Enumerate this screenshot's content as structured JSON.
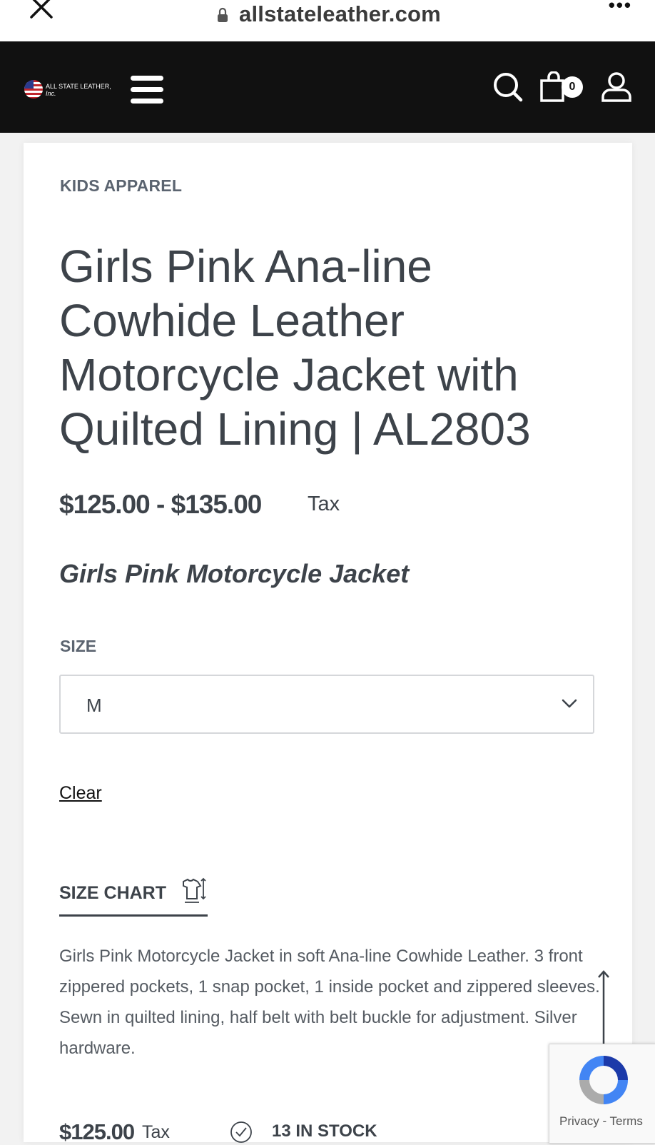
{
  "browser": {
    "url": "allstateleather.com",
    "menu_label": "•••"
  },
  "header": {
    "logo_line1": "ALL STATE LEATHER,",
    "logo_line2": "Inc.",
    "cart_count": "0"
  },
  "product": {
    "category": "KIDS APPAREL",
    "title": "Girls Pink Ana-line Cowhide Leather Motorcycle Jacket with Quilted Lining | AL2803",
    "price_range": "$125.00 - $135.00",
    "price_tax_label": "Tax",
    "subtitle": "Girls Pink Motorcycle Jacket",
    "size_label": "SIZE",
    "size_selected": "M",
    "clear_label": "Clear",
    "size_chart_label": "SIZE CHART",
    "description": "Girls Pink Motorcycle Jacket in soft Ana-line Cowhide Leather. 3 front zippered pockets, 1 snap pocket, 1 inside pocket and zippered sleeves. Sewn in quilted lining, half belt with belt buckle for adjustment. Silver hardware.",
    "variant_price": "$125.00",
    "variant_tax_label": "Tax",
    "stock_status": "13 IN STOCK"
  },
  "recaptcha": {
    "privacy": "Privacy",
    "separator": " - ",
    "terms": "Terms"
  },
  "colors": {
    "header_bg": "#111111",
    "text": "#3d434a",
    "muted": "#5b6470"
  }
}
